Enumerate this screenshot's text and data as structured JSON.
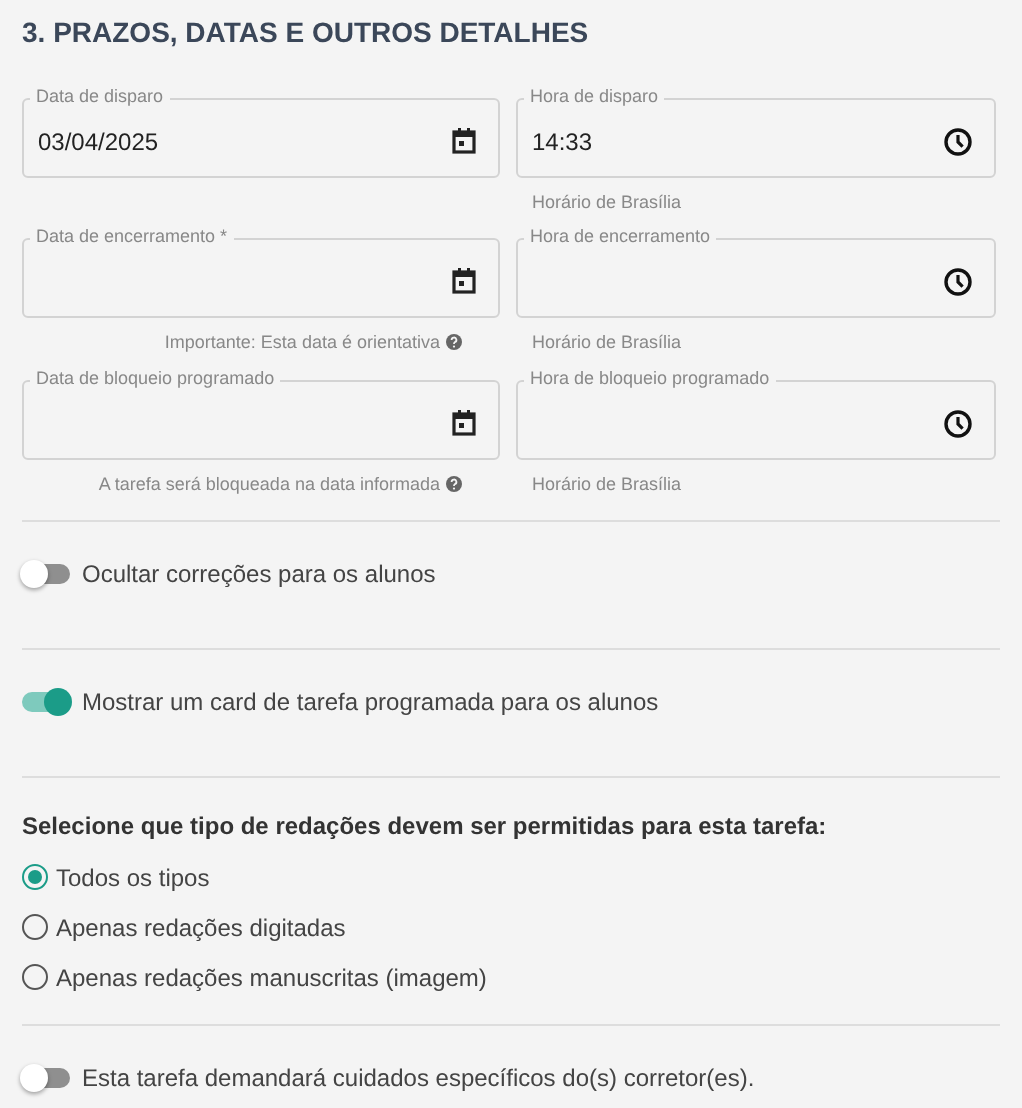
{
  "section_title": "3. PRAZOS, DATAS E OUTROS DETALHES",
  "fields": [
    {
      "label": "Data de disparo",
      "kind": "date",
      "value": "03/04/2025"
    },
    {
      "label": "Hora de disparo",
      "kind": "time",
      "value": "14:33",
      "helper": {
        "text": "Horário de Brasília",
        "info": false
      }
    },
    {
      "label": "Data de encerramento *",
      "kind": "date",
      "helper": {
        "text": "Importante: Esta data é orientativa",
        "info": true
      }
    },
    {
      "label": "Hora de encerramento",
      "kind": "time",
      "helper": {
        "text": "Horário de Brasília",
        "info": false
      }
    },
    {
      "label": "Data de bloqueio programado",
      "kind": "date",
      "helper": {
        "text": "A tarefa será bloqueada na data informada",
        "info": true
      }
    },
    {
      "label": "Hora de bloqueio programado",
      "kind": "time",
      "helper": {
        "text": "Horário de Brasília",
        "info": false
      }
    }
  ],
  "hide_corrections": {
    "label": "Ocultar correções para os alunos",
    "on": false
  },
  "show_card": {
    "label": "Mostrar um card de tarefa programada para os alunos",
    "on": true
  },
  "essay_types": {
    "question": "Selecione que tipo de redações devem ser permitidas para esta tarefa:",
    "options": [
      {
        "label": "Todos os tipos",
        "selected": true
      },
      {
        "label": "Apenas redações digitadas",
        "selected": false
      },
      {
        "label": "Apenas redações manuscritas (imagem)",
        "selected": false
      }
    ]
  },
  "special_care": {
    "label": "Esta tarefa demandará cuidados específicos do(s) corretor(es).",
    "on": false
  }
}
